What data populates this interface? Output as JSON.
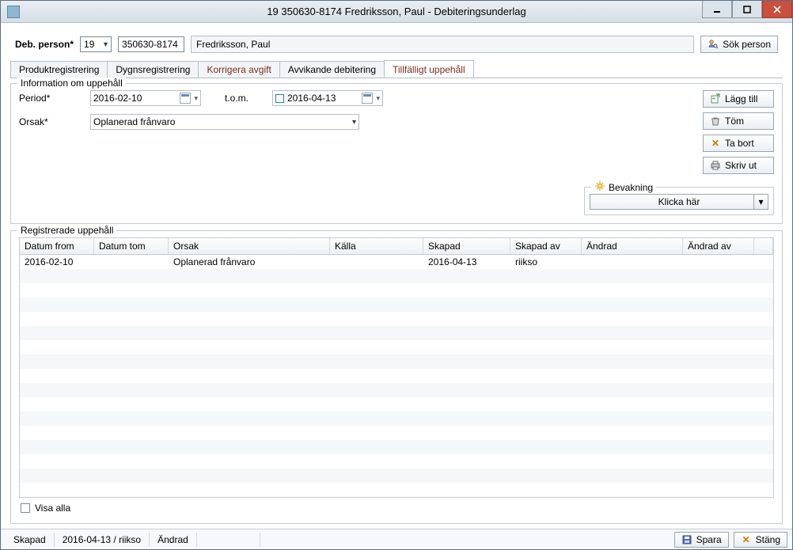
{
  "window": {
    "title": "19 350630-8174   Fredriksson, Paul   -   Debiteringsunderlag"
  },
  "person": {
    "label": "Deb. person*",
    "prefix": "19",
    "pnr": "350630-8174",
    "name": "Fredriksson, Paul",
    "search_btn": "Sök person"
  },
  "tabs": {
    "t0": "Produktregistrering",
    "t1": "Dygnsregistrering",
    "t2": "Korrigera avgift",
    "t3": "Avvikande debitering",
    "t4": "Tillfälligt uppehåll"
  },
  "form": {
    "legend": "Information om uppehåll",
    "period_label": "Period*",
    "period_from": "2016-02-10",
    "tom_label": "t.o.m.",
    "period_to": "2016-04-13",
    "orsak_label": "Orsak*",
    "orsak_value": "Oplanerad frånvaro",
    "buttons": {
      "add": "Lägg till",
      "clear": "Töm",
      "delete": "Ta bort",
      "print": "Skriv ut"
    },
    "bevakning": {
      "legend": "Bevakning",
      "dropdown": "Klicka här"
    }
  },
  "table": {
    "legend": "Registrerade uppehåll",
    "headers": {
      "c0": "Datum from",
      "c1": "Datum tom",
      "c2": "Orsak",
      "c3": "Källa",
      "c4": "Skapad",
      "c5": "Skapad av",
      "c6": "Ändrad",
      "c7": "Ändrad av"
    },
    "rows": [
      {
        "c0": "2016-02-10",
        "c1": "",
        "c2": "Oplanerad frånvaro",
        "c3": "",
        "c4": "2016-04-13",
        "c5": "riikso",
        "c6": "",
        "c7": ""
      }
    ],
    "show_all": "Visa alla"
  },
  "status": {
    "created_label": "Skapad",
    "created_value": "2016-04-13 / riikso",
    "changed_label": "Ändrad",
    "changed_value": "",
    "save": "Spara",
    "close": "Stäng"
  }
}
